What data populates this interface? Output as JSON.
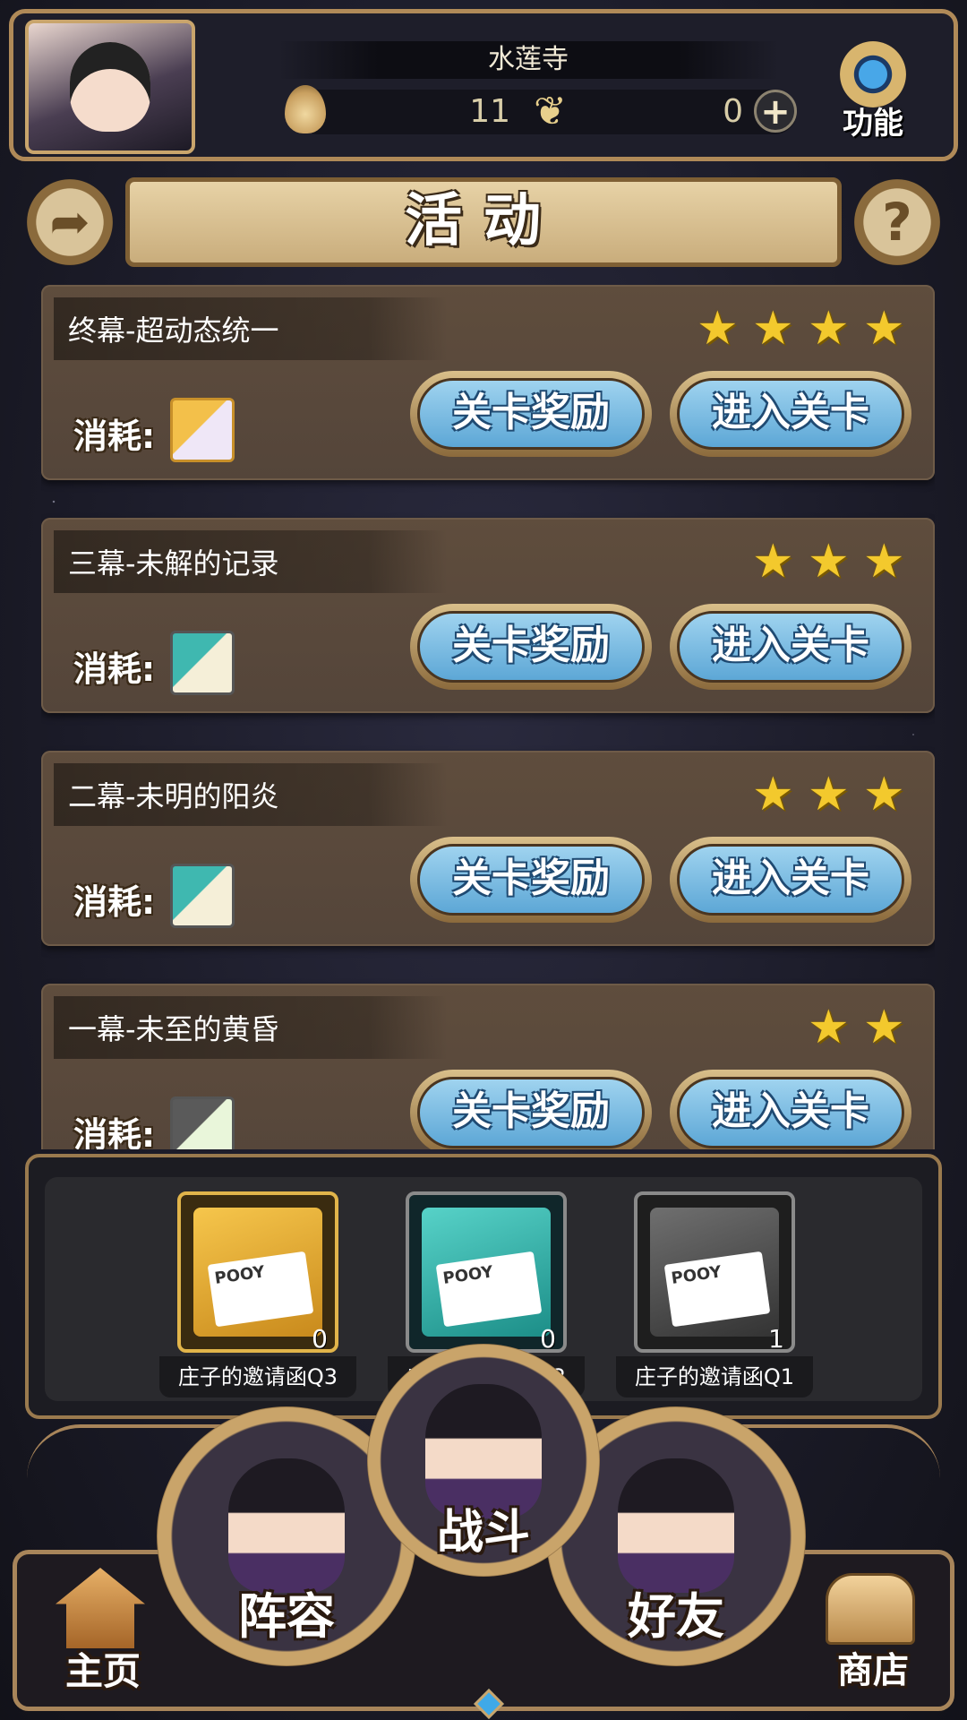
{
  "header": {
    "player_name": "水莲寺",
    "resource1_value": "11",
    "resource2_value": "0",
    "function_label": "功能"
  },
  "title": "活动",
  "cost_label": "消耗:",
  "stages": [
    {
      "name": "终幕-超动态统一",
      "stars": 4,
      "cost_item": "gold",
      "reward_label": "关卡奖励",
      "enter_label": "进入关卡"
    },
    {
      "name": "三幕-未解的记录",
      "stars": 3,
      "cost_item": "teal",
      "reward_label": "关卡奖励",
      "enter_label": "进入关卡"
    },
    {
      "name": "二幕-未明的阳炎",
      "stars": 3,
      "cost_item": "teal",
      "reward_label": "关卡奖励",
      "enter_label": "进入关卡"
    },
    {
      "name": "一幕-未至的黄昏",
      "stars": 2,
      "cost_item": "gray",
      "reward_label": "关卡奖励",
      "enter_label": "进入关卡"
    }
  ],
  "inventory": [
    {
      "name": "庄子的邀请函Q3",
      "count": "0",
      "disk_text": "POOY",
      "color": "#f3c04a"
    },
    {
      "name": "庄子的邀请函Q2",
      "count": "0",
      "disk_text": "POOY",
      "color": "#3fb8b0"
    },
    {
      "name": "庄子的邀请函Q1",
      "count": "1",
      "disk_text": "POOY",
      "color": "#5a5a5a"
    }
  ],
  "nav": {
    "home": "主页",
    "team": "阵容",
    "battle": "战斗",
    "friends": "好友",
    "shop": "商店"
  }
}
